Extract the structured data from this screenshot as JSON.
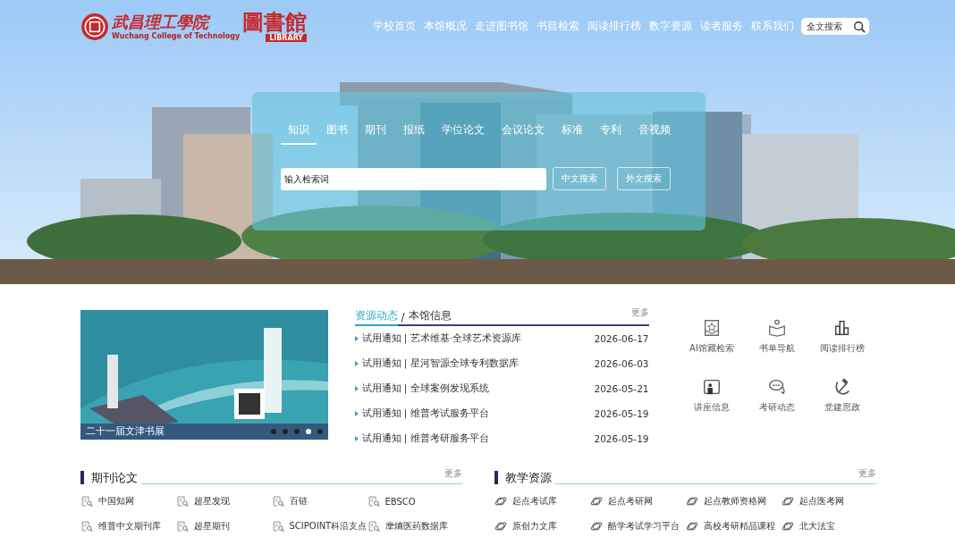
{
  "logo": {
    "school": "武昌理工學院",
    "library": "圖書館",
    "english": "Wuchang College of Technology",
    "badge": "LIBRARY"
  },
  "nav": [
    "学校首页",
    "本馆概况",
    "走进图书馆",
    "书目检索",
    "阅读排行榜",
    "数字资源",
    "读者服务",
    "联系我们"
  ],
  "site_search": {
    "placeholder": "全文搜索"
  },
  "search_panel": {
    "tabs": [
      {
        "label": "知识",
        "selected": true
      },
      {
        "label": "图书",
        "selected": false
      },
      {
        "label": "期刊",
        "selected": false
      },
      {
        "label": "报纸",
        "selected": false
      },
      {
        "label": "学位论文",
        "selected": false
      },
      {
        "label": "会议论文",
        "selected": false
      },
      {
        "label": "标准",
        "selected": false
      },
      {
        "label": "专利",
        "selected": false
      },
      {
        "label": "音视频",
        "selected": false
      }
    ],
    "placeholder": "输入检索词",
    "buttons": [
      "中文搜索",
      "外文搜索"
    ]
  },
  "carousel": {
    "caption": "二十一届文津书展",
    "dots": [
      {
        "selected": false
      },
      {
        "selected": false
      },
      {
        "selected": false
      },
      {
        "selected": true
      },
      {
        "selected": false
      }
    ]
  },
  "news": {
    "separator": "/",
    "tabs": [
      {
        "label": "资源动态",
        "selected": true
      },
      {
        "label": "本馆信息",
        "selected": false
      }
    ],
    "more": "更多",
    "items": [
      {
        "title": "试用通知 | 艺术维基·全球艺术资源库",
        "date": "2026-06-17"
      },
      {
        "title": "试用通知 | 星河智源全球专利数据库",
        "date": "2026-06-03"
      },
      {
        "title": "试用通知 | 全球案例发现系统",
        "date": "2026-05-21"
      },
      {
        "title": "试用通知 | 维普考试服务平台",
        "date": "2026-05-19"
      },
      {
        "title": "试用通知 | 维普考研服务平台",
        "date": "2026-05-19"
      }
    ]
  },
  "quick_links": [
    {
      "label": "AI馆藏检索",
      "kind": "star"
    },
    {
      "label": "书单导航",
      "kind": "reader"
    },
    {
      "label": "阅读排行榜",
      "kind": "chart"
    },
    {
      "label": "讲座信息",
      "kind": "lecture"
    },
    {
      "label": "考研动态",
      "kind": "chat"
    },
    {
      "label": "党建思政",
      "kind": "emblem"
    }
  ],
  "sections": [
    {
      "title": "期刊论文",
      "more": "更多",
      "kind": "journal",
      "links": [
        "中国知网",
        "超星发现",
        "百链",
        "EBSCO",
        "维普中文期刊库",
        "超星期刊",
        "SCIPOINT科沿支点",
        "摩熵医药数据库"
      ]
    },
    {
      "title": "教学资源",
      "more": "更多",
      "kind": "teaching",
      "links": [
        "起点考试库",
        "起点考研网",
        "起点教师资格网",
        "起点医考网",
        "原创力文库",
        "酷学考试学习平台",
        "高校考研精品课程",
        "北大法宝"
      ]
    }
  ]
}
